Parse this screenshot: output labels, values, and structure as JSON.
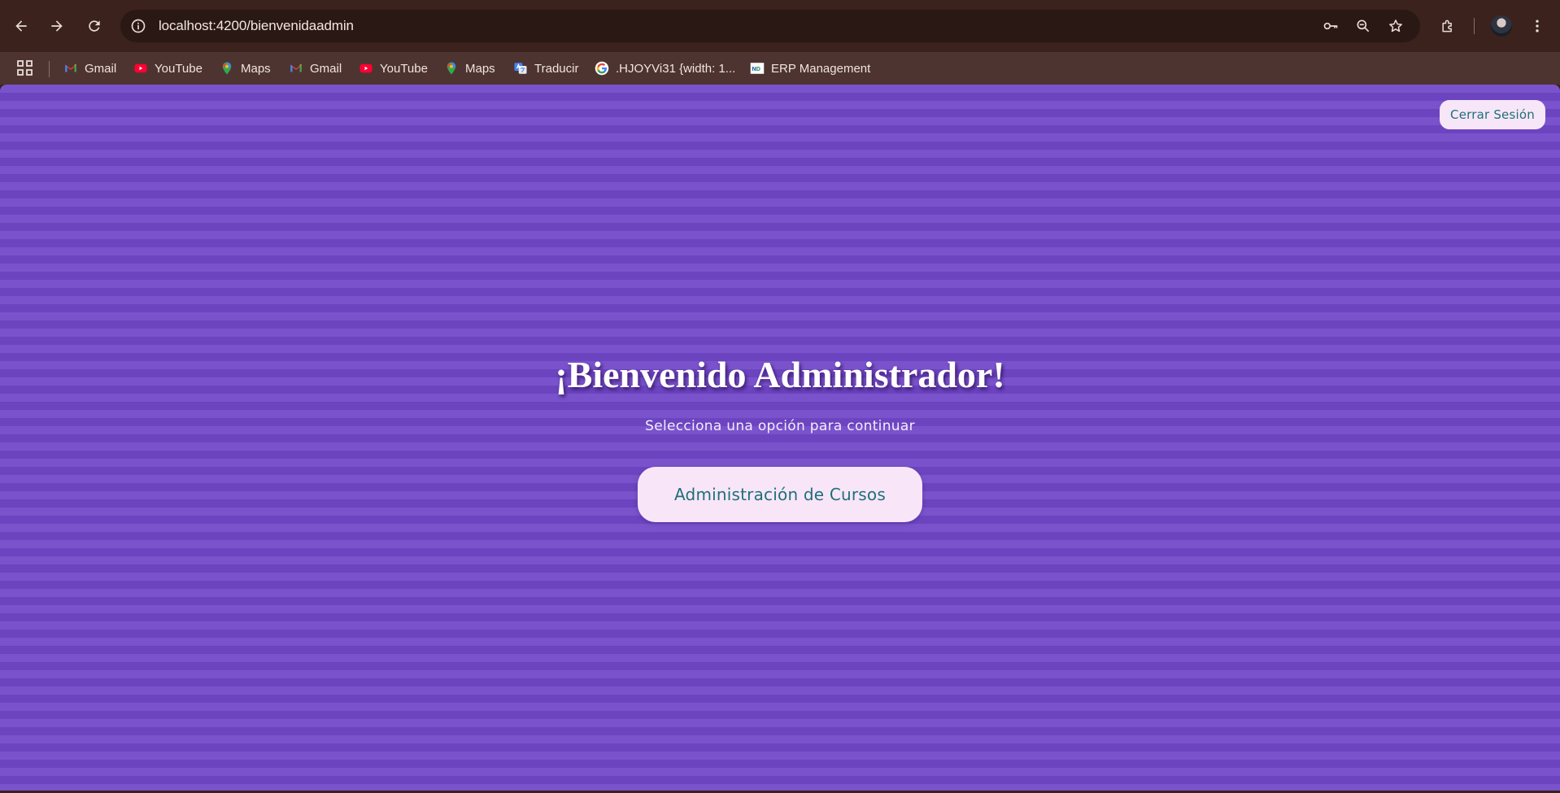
{
  "browser": {
    "url": "localhost:4200/bienvenidaadmin",
    "colors": {
      "toolbar": "#3b221d",
      "omnibox": "#2a1814",
      "bookmarks_bar": "#4e3430",
      "text": "#efe4e1"
    },
    "bookmarks": [
      {
        "label": "Gmail",
        "icon": "gmail-icon"
      },
      {
        "label": "YouTube",
        "icon": "youtube-icon"
      },
      {
        "label": "Maps",
        "icon": "maps-icon"
      },
      {
        "label": "Gmail",
        "icon": "gmail-icon"
      },
      {
        "label": "YouTube",
        "icon": "youtube-icon"
      },
      {
        "label": "Maps",
        "icon": "maps-icon"
      },
      {
        "label": "Traducir",
        "icon": "translate-icon"
      },
      {
        "label": ".HJOYVi31 {width: 1...",
        "icon": "google-icon"
      },
      {
        "label": "ERP Management",
        "icon": "erp-icon"
      }
    ]
  },
  "page": {
    "logout_label": "Cerrar Sesión",
    "title": "¡Bienvenido Administrador!",
    "subtitle": "Selecciona una opción para continuar",
    "courses_button_label": "Administración de Cursos",
    "colors": {
      "background_stripe_light": "#7a53cc",
      "background_stripe_dark": "#6c44c0",
      "button_background": "#f8e6f8",
      "button_text": "#1f6f78"
    }
  }
}
